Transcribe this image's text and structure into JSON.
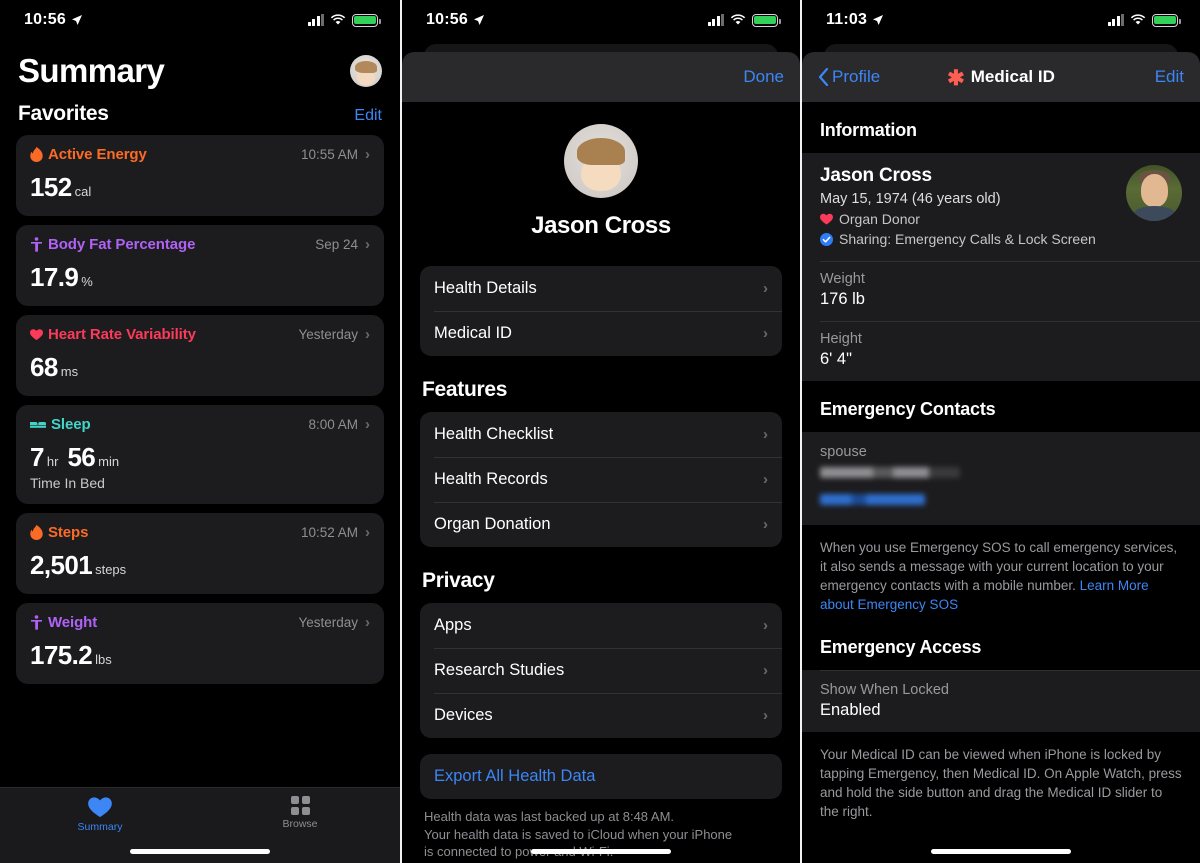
{
  "panel1": {
    "statusbar": {
      "time": "10:56",
      "location_icon": "location-arrow-icon",
      "signal_icon": "cellular-signal-icon",
      "wifi_icon": "wifi-icon",
      "battery_icon": "battery-charging-icon"
    },
    "page_title": "Summary",
    "avatar_name": "memoji-avatar",
    "section_title": "Favorites",
    "edit_label": "Edit",
    "cards": [
      {
        "name": "Active Energy",
        "color": "#fb6b26",
        "icon": "flame-icon",
        "time": "10:55 AM",
        "value": "152",
        "unit": "cal",
        "sub": ""
      },
      {
        "name": "Body Fat Percentage",
        "color": "#b062f6",
        "icon": "body-figure-icon",
        "time": "Sep 24",
        "value": "17.9",
        "unit": "%",
        "sub": ""
      },
      {
        "name": "Heart Rate Variability",
        "color": "#fc3a5a",
        "icon": "heart-icon",
        "time": "Yesterday",
        "value": "68",
        "unit": "ms",
        "sub": ""
      },
      {
        "name": "Sleep",
        "color": "#44d3c8",
        "icon": "bed-icon",
        "time": "8:00 AM",
        "value": "7",
        "unit": "hr",
        "value2": "56",
        "unit2": "min",
        "sub": "Time In Bed"
      },
      {
        "name": "Steps",
        "color": "#fb6b26",
        "icon": "flame-icon",
        "time": "10:52 AM",
        "value": "2,501",
        "unit": "steps",
        "sub": ""
      },
      {
        "name": "Weight",
        "color": "#b062f6",
        "icon": "body-figure-icon",
        "time": "Yesterday",
        "value": "175.2",
        "unit": "lbs",
        "sub": ""
      }
    ],
    "tabs": [
      {
        "label": "Summary",
        "icon": "heart-icon",
        "active": true
      },
      {
        "label": "Browse",
        "icon": "grid-icon",
        "active": false
      }
    ]
  },
  "panel2": {
    "statusbar": {
      "time": "10:56"
    },
    "done_label": "Done",
    "profile_name": "Jason Cross",
    "profile_avatar": "memoji-avatar",
    "main_items": [
      {
        "label": "Health Details"
      },
      {
        "label": "Medical ID"
      }
    ],
    "features_title": "Features",
    "features_items": [
      {
        "label": "Health Checklist"
      },
      {
        "label": "Health Records"
      },
      {
        "label": "Organ Donation"
      }
    ],
    "privacy_title": "Privacy",
    "privacy_items": [
      {
        "label": "Apps"
      },
      {
        "label": "Research Studies"
      },
      {
        "label": "Devices"
      }
    ],
    "export_label": "Export All Health Data",
    "footer_line1": "Health data was last backed up at 8:48 AM.",
    "footer_line2": "Your health data is saved to iCloud when your iPhone",
    "footer_line3": "is connected to power and Wi-Fi."
  },
  "panel3": {
    "statusbar": {
      "time": "11:03"
    },
    "back_label": "Profile",
    "nav_title": "Medical ID",
    "nav_icon": "medical-asterisk-icon",
    "edit_label": "Edit",
    "information_title": "Information",
    "person": {
      "name": "Jason Cross",
      "dob": "May 15, 1974 (46 years old)",
      "organ_donor": "Organ Donor",
      "sharing": "Sharing: Emergency Calls & Lock Screen",
      "photo": "profile-photo"
    },
    "fields": [
      {
        "key": "Weight",
        "value": "176 lb"
      },
      {
        "key": "Height",
        "value": "6' 4\""
      }
    ],
    "emergency_contacts_title": "Emergency Contacts",
    "contact_relation": "spouse",
    "contact_name_redacted": "[redacted]",
    "contact_phone_redacted": "[redacted]",
    "sos_note": "When you use Emergency SOS to call emergency services, it also sends a message with your current location to your emergency contacts with a mobile number. ",
    "sos_link": "Learn More about Emergency SOS",
    "emergency_access_title": "Emergency Access",
    "show_when_locked_key": "Show When Locked",
    "show_when_locked_value": "Enabled",
    "access_note": "Your Medical ID can be viewed when iPhone is locked by tapping Emergency, then Medical ID. On Apple Watch, press and hold the side button and drag the Medical ID slider to the right."
  }
}
